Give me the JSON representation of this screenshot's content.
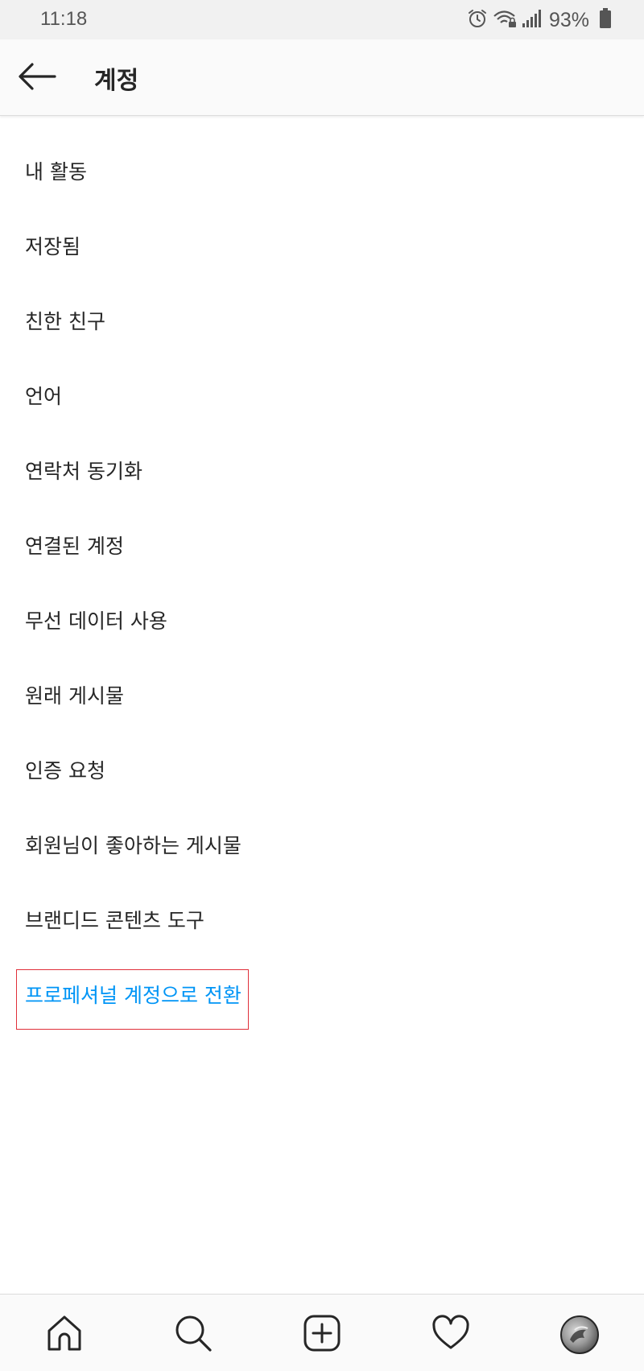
{
  "status_bar": {
    "time": "11:18",
    "battery_text": "93%",
    "icons": [
      "alarm-icon",
      "wifi-lock-icon",
      "signal-icon",
      "battery-icon"
    ]
  },
  "header": {
    "title": "계정",
    "back_icon": "arrow-left-icon"
  },
  "menu": {
    "items": [
      {
        "label": "내 활동"
      },
      {
        "label": "저장됨"
      },
      {
        "label": "친한 친구"
      },
      {
        "label": "언어"
      },
      {
        "label": "연락처 동기화"
      },
      {
        "label": "연결된 계정"
      },
      {
        "label": "무선 데이터 사용"
      },
      {
        "label": "원래 게시물"
      },
      {
        "label": "인증 요청"
      },
      {
        "label": "회원님이 좋아하는 게시물"
      },
      {
        "label": "브랜디드 콘텐츠 도구"
      },
      {
        "label": "프로페셔널 계정으로 전환"
      }
    ]
  },
  "bottom_nav": {
    "items": [
      "home-icon",
      "search-icon",
      "new-post-icon",
      "activity-heart-icon",
      "profile-avatar"
    ]
  },
  "colors": {
    "accent": "#0095f6",
    "text": "#262626",
    "highlight_border": "#e0303a",
    "status_bar_bg": "#f1f1f1",
    "header_bg": "#fafafa"
  }
}
